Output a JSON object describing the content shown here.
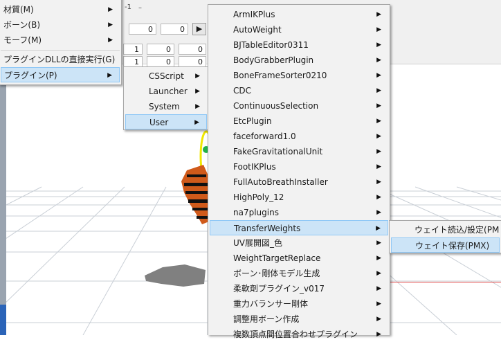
{
  "main_menu": {
    "items": [
      {
        "label": "材質(M)",
        "submenu": true
      },
      {
        "label": "ボーン(B)",
        "submenu": true
      },
      {
        "label": "モーフ(M)",
        "submenu": true
      },
      {
        "label": "プラグインDLLの直接実行(G)",
        "submenu": false
      },
      {
        "label": "プラグイン(P)",
        "submenu": true
      }
    ]
  },
  "plugin_menu": {
    "items": [
      {
        "label": "CSScript"
      },
      {
        "label": "Launcher"
      },
      {
        "label": "System"
      },
      {
        "label": "User"
      }
    ]
  },
  "user_menu": {
    "items": [
      {
        "label": "ArmIKPlus"
      },
      {
        "label": "AutoWeight"
      },
      {
        "label": "BJTableEditor0311"
      },
      {
        "label": "BodyGrabberPlugin"
      },
      {
        "label": "BoneFrameSorter0210"
      },
      {
        "label": "CDC"
      },
      {
        "label": "ContinuousSelection"
      },
      {
        "label": "EtcPlugin"
      },
      {
        "label": "faceforward1.0"
      },
      {
        "label": "FakeGravitationalUnit"
      },
      {
        "label": "FootIKPlus"
      },
      {
        "label": "FullAutoBreathInstaller"
      },
      {
        "label": "HighPoly_12"
      },
      {
        "label": "na7plugins"
      },
      {
        "label": "TransferWeights"
      },
      {
        "label": "UV展開図_色"
      },
      {
        "label": "WeightTargetReplace"
      },
      {
        "label": "ボーン･剛体モデル生成"
      },
      {
        "label": "柔軟剤プラグイン_v017"
      },
      {
        "label": "重力バランサー剛体"
      },
      {
        "label": "調整用ボーン作成"
      },
      {
        "label": "複数頂点間位置合わせプラグイン"
      }
    ]
  },
  "transfer_menu": {
    "items": [
      {
        "label": "ウェイト読込/設定(PMX)"
      },
      {
        "label": "ウェイト保存(PMX)"
      }
    ]
  },
  "panel": {
    "header_value": "-1",
    "row1": [
      "0",
      "0"
    ],
    "row2": [
      "1",
      "0",
      "0"
    ],
    "row3": [
      "1",
      "0",
      "0"
    ],
    "next_arrow": "▶"
  },
  "icons": {
    "submenu_arrow": "▶"
  }
}
